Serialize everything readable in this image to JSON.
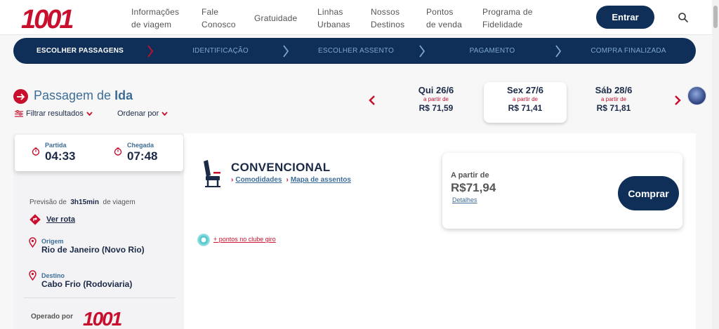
{
  "header": {
    "logo_text": "1001",
    "nav": [
      {
        "line1": "Informações",
        "line2": "de viagem"
      },
      {
        "line1": "Fale",
        "line2": "Conosco"
      },
      {
        "line1": "Gratuidade",
        "line2": ""
      },
      {
        "line1": "Linhas",
        "line2": "Urbanas"
      },
      {
        "line1": "Nossos",
        "line2": "Destinos"
      },
      {
        "line1": "Pontos",
        "line2": "de venda"
      },
      {
        "line1": "Programa de",
        "line2": "Fidelidade"
      }
    ],
    "enter_label": "Entrar",
    "icons": {
      "search": "search-icon"
    }
  },
  "steps": [
    {
      "label": "ESCOLHER PASSAGENS",
      "active": true
    },
    {
      "label": "IDENTIFICAÇÃO",
      "active": false
    },
    {
      "label": "ESCOLHER ASSENTO",
      "active": false
    },
    {
      "label": "PAGAMENTO",
      "active": false
    },
    {
      "label": "COMPRA FINALIZADA",
      "active": false
    }
  ],
  "title": {
    "prefix": "Passagem de ",
    "bold": "Ida"
  },
  "filters": {
    "filter_label": "Filtrar resultados",
    "order_label": "Ordenar por"
  },
  "dates": [
    {
      "day": "Qui 26/6",
      "from": "a partir de",
      "price": "R$ 71,59",
      "selected": false
    },
    {
      "day": "Sex 27/6",
      "from": "a partir de",
      "price": "R$ 71,41",
      "selected": true
    },
    {
      "day": "Sáb 28/6",
      "from": "a partir de",
      "price": "R$ 71,81",
      "selected": false
    }
  ],
  "trip": {
    "departure_label": "Partida",
    "departure_time": "04:33",
    "arrival_label": "Chegada",
    "arrival_time": "07:48",
    "forecast_prefix": "Previsão de",
    "duration": "3h15min",
    "forecast_suffix": "de viagem",
    "route_link": "Ver rota",
    "origin_label": "Origem",
    "origin": "Rio de Janeiro (Novo Rio)",
    "destination_label": "Destino",
    "destination": "Cabo Frio (Rodoviaria)",
    "operated_by": "Operado por",
    "operator_logo_text": "1001"
  },
  "service": {
    "class_name": "CONVENCIONAL",
    "amenities_link": "Comodidades",
    "seat_map_link": "Mapa de assentos",
    "points_link": "+ pontos no clube giro"
  },
  "offer": {
    "from_label": "A partir de",
    "price": "R$71,94",
    "details_link": "Detalhes",
    "buy_label": "Comprar"
  },
  "colors": {
    "brand_red": "#c8102e",
    "navy": "#0f2f58",
    "link_blue": "#3d6d96"
  }
}
